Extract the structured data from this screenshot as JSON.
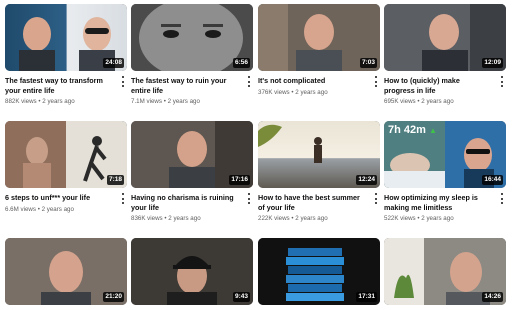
{
  "videos": [
    {
      "title": "The fastest way to transform your entire life",
      "views": "882K views",
      "age": "2 years ago",
      "duration": "24:08"
    },
    {
      "title": "The fastest way to ruin your entire life",
      "views": "7.1M views",
      "age": "2 years ago",
      "duration": "6:56"
    },
    {
      "title": "It's not complicated",
      "views": "376K views",
      "age": "2 years ago",
      "duration": "7:03"
    },
    {
      "title": "How to (quickly) make progress in life",
      "views": "695K views",
      "age": "2 years ago",
      "duration": "12:09"
    },
    {
      "title": "6 steps to unf*** your life",
      "views": "6.6M views",
      "age": "2 years ago",
      "duration": "7:18"
    },
    {
      "title": "Having no charisma is ruining your life",
      "views": "836K views",
      "age": "2 years ago",
      "duration": "17:16"
    },
    {
      "title": "How to have the best summer of your life",
      "views": "222K views",
      "age": "2 years ago",
      "duration": "12:24"
    },
    {
      "title": "How optimizing my sleep is making me limitless",
      "views": "522K views",
      "age": "2 years ago",
      "duration": "16:44",
      "overlay": "7h 42m",
      "overlay_arrow": "▲"
    },
    {
      "duration": "21:20"
    },
    {
      "duration": "9:43"
    },
    {
      "duration": "17:31"
    },
    {
      "duration": "14:26"
    }
  ],
  "separator": "•",
  "colors": {
    "duration_bg": "#000000",
    "title": "#0f0f0f",
    "stats": "#606060",
    "overlay_up": "#3ec24a"
  }
}
